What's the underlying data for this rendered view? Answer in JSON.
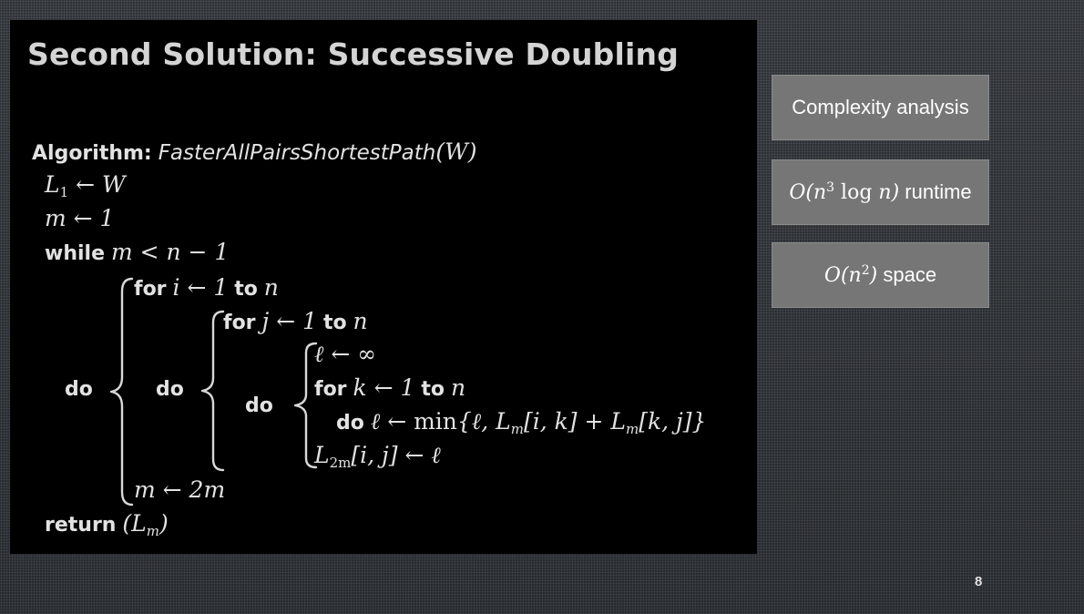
{
  "slide": {
    "title": "Second Solution: Successive Doubling",
    "page_number": "8"
  },
  "algorithm": {
    "label": "Algorithm:",
    "name": "FasterAllPairsShortestPath",
    "param": "(W)",
    "init_l1_lhs": "L",
    "init_l1_sub": "1",
    "init_l1_rhs": " ← W",
    "init_m": "m ← 1",
    "while_kw": "while",
    "while_cond": "m < n − 1",
    "do_outer": "do",
    "for_i_kw": "for",
    "for_i_var": "i ← 1",
    "to_kw": "to",
    "n_var": "n",
    "do_middle": "do",
    "for_j_kw": "for",
    "for_j_var": "j ← 1",
    "do_inner": "do",
    "ell_init": "ℓ ← ∞",
    "for_k_kw": "for",
    "for_k_var": "k ← 1",
    "do_min_kw": "do",
    "min_expr_a": "ℓ ← ",
    "min_fn": "min",
    "min_expr_b": "{ℓ, L",
    "min_sub_1": "m",
    "min_expr_c": "[i, k] + L",
    "min_sub_2": "m",
    "min_expr_d": "[k, j]}",
    "assign_lhs": "L",
    "assign_sub": "2m",
    "assign_rhs": "[i, j] ← ℓ",
    "m_double": "m ← 2m",
    "return_kw": "return",
    "return_open": "(L",
    "return_sub": "m",
    "return_close": ")"
  },
  "cards": [
    {
      "label": "Complexity analysis"
    },
    {
      "math_o": "O",
      "math_open": "(n",
      "math_sup": "3",
      "math_log": " log",
      "math_n": " n",
      "math_close": ")",
      "text": " runtime"
    },
    {
      "math_o": "O",
      "math_open": "(n",
      "math_sup": "2",
      "math_close": ")",
      "text": " space"
    }
  ]
}
